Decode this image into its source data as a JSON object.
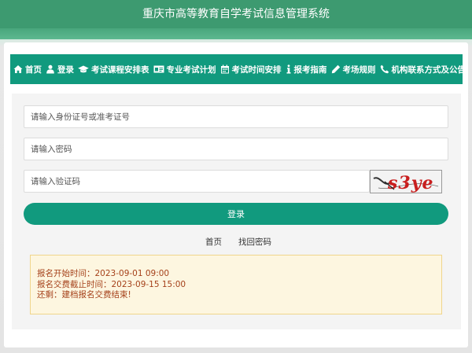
{
  "header": {
    "title": "重庆市高等教育自学考试信息管理系统"
  },
  "nav": {
    "items": [
      {
        "label": "首页",
        "icon": "home-icon"
      },
      {
        "label": "登录",
        "icon": "user-icon"
      },
      {
        "label": "考试课程安排表",
        "icon": "graduation-cap-icon"
      },
      {
        "label": "专业考试计划",
        "icon": "id-card-icon"
      },
      {
        "label": "考试时间安排",
        "icon": "calendar-icon"
      },
      {
        "label": "报考指南",
        "icon": "info-icon"
      },
      {
        "label": "考场规则",
        "icon": "pencil-icon"
      },
      {
        "label": "机构联系方式及公告",
        "icon": "phone-icon"
      }
    ]
  },
  "form": {
    "id_placeholder": "请输入身份证号或准考证号",
    "password_placeholder": "请输入密码",
    "captcha_placeholder": "请输入验证码",
    "captcha_text": "s3ye",
    "login_label": "登录"
  },
  "links": {
    "home": "首页",
    "recover_password": "找回密码"
  },
  "notice": {
    "start": "报名开始时间：2023-09-01 09:00",
    "deadline": "报名交费截止时间：2023-09-15 15:00",
    "remaining": "还剩：建档报名交费结束!"
  },
  "colors": {
    "brand": "#119a7e",
    "header": "#3d9a70",
    "notice_text": "#a5411a",
    "notice_bg": "#fdf6e0"
  }
}
